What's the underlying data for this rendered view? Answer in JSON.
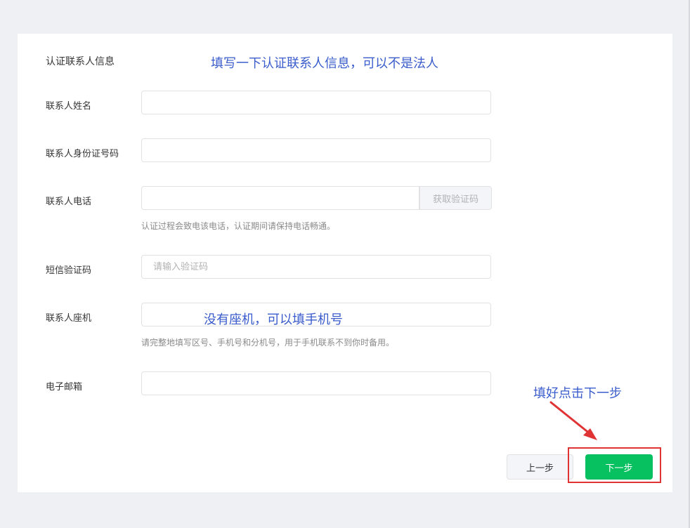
{
  "section": {
    "title": "认证联系人信息"
  },
  "annotations": {
    "top": "填写一下认证联系人信息，可以不是法人",
    "landline": "没有座机，可以填手机号",
    "next": "填好点击下一步",
    "color": "#3a5ccc"
  },
  "fields": {
    "name": {
      "label": "联系人姓名",
      "value": ""
    },
    "id_number": {
      "label": "联系人身份证号码",
      "value": ""
    },
    "phone": {
      "label": "联系人电话",
      "value": "",
      "button": "获取验证码",
      "hint": "认证过程会致电该电话，认证期间请保持电话畅通。"
    },
    "sms_code": {
      "label": "短信验证码",
      "placeholder": "请输入验证码",
      "value": ""
    },
    "landline": {
      "label": "联系人座机",
      "value": "",
      "hint": "请完整地填写区号、手机号和分机号，用于手机联系不到你时备用。"
    },
    "email": {
      "label": "电子邮箱",
      "value": ""
    }
  },
  "buttons": {
    "prev": "上一步",
    "next": "下一步"
  },
  "colors": {
    "primary": "#07c160",
    "highlight_border": "#e03434"
  }
}
